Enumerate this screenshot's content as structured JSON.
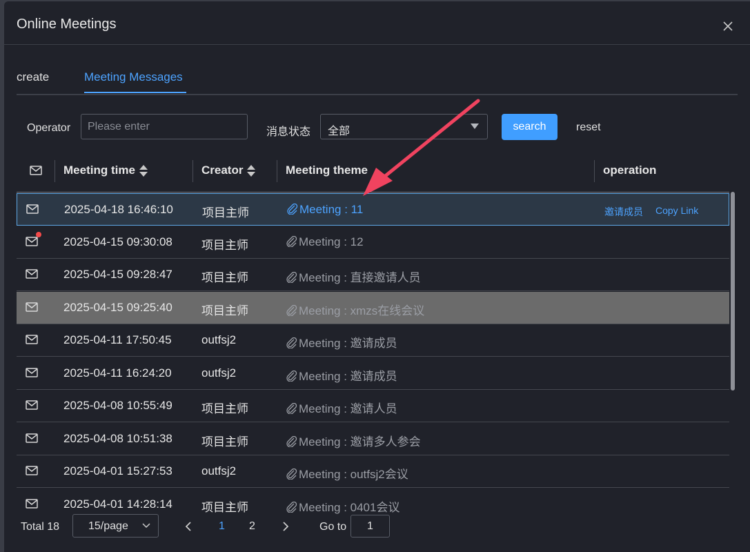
{
  "dialog": {
    "title": "Online Meetings"
  },
  "tabs": [
    {
      "label": "create",
      "active": false
    },
    {
      "label": "Meeting Messages",
      "active": true
    }
  ],
  "filters": {
    "operator_label": "Operator",
    "operator_placeholder": "Please enter",
    "status_label": "消息状态",
    "status_value": "全部",
    "search_label": "search",
    "reset_label": "reset"
  },
  "table": {
    "headers": {
      "time": "Meeting time",
      "creator": "Creator",
      "theme": "Meeting theme",
      "operation": "operation"
    },
    "rows": [
      {
        "time": "2025-04-18 16:46:10",
        "creator": "项目主师",
        "theme": "Meeting : 11",
        "unread": false,
        "selected": true,
        "invite": "邀请成员",
        "copy": "Copy Link"
      },
      {
        "time": "2025-04-15 09:30:08",
        "creator": "项目主师",
        "theme": "Meeting : 12",
        "unread": true
      },
      {
        "time": "2025-04-15 09:28:47",
        "creator": "项目主师",
        "theme": "Meeting : 直接邀请人员",
        "unread": false
      },
      {
        "time": "2025-04-15 09:25:40",
        "creator": "项目主师",
        "theme": "Meeting : xmzs在线会议",
        "unread": false,
        "hovered": true
      },
      {
        "time": "2025-04-11 17:50:45",
        "creator": "outfsj2",
        "theme": "Meeting : 邀请成员",
        "unread": false
      },
      {
        "time": "2025-04-11 16:24:20",
        "creator": "outfsj2",
        "theme": "Meeting : 邀请成员",
        "unread": false
      },
      {
        "time": "2025-04-08 10:55:49",
        "creator": "项目主师",
        "theme": "Meeting : 邀请人员",
        "unread": false
      },
      {
        "time": "2025-04-08 10:51:38",
        "creator": "项目主师",
        "theme": "Meeting : 邀请多人参会",
        "unread": false
      },
      {
        "time": "2025-04-01 15:27:53",
        "creator": "outfsj2",
        "theme": "Meeting : outfsj2会议",
        "unread": false
      },
      {
        "time": "2025-04-01 14:28:14",
        "creator": "项目主师",
        "theme": "Meeting : 0401会议",
        "unread": false
      }
    ]
  },
  "pagination": {
    "total": "Total 18",
    "page_size": "15/page",
    "pages": [
      "1",
      "2"
    ],
    "current": "1",
    "goto_label": "Go to",
    "goto_value": "1"
  },
  "colors": {
    "accent": "#409eff",
    "link": "#4da3ff",
    "background": "#20222a",
    "unread_dot": "#f44a4a",
    "annotation_arrow": "#f0435f"
  }
}
